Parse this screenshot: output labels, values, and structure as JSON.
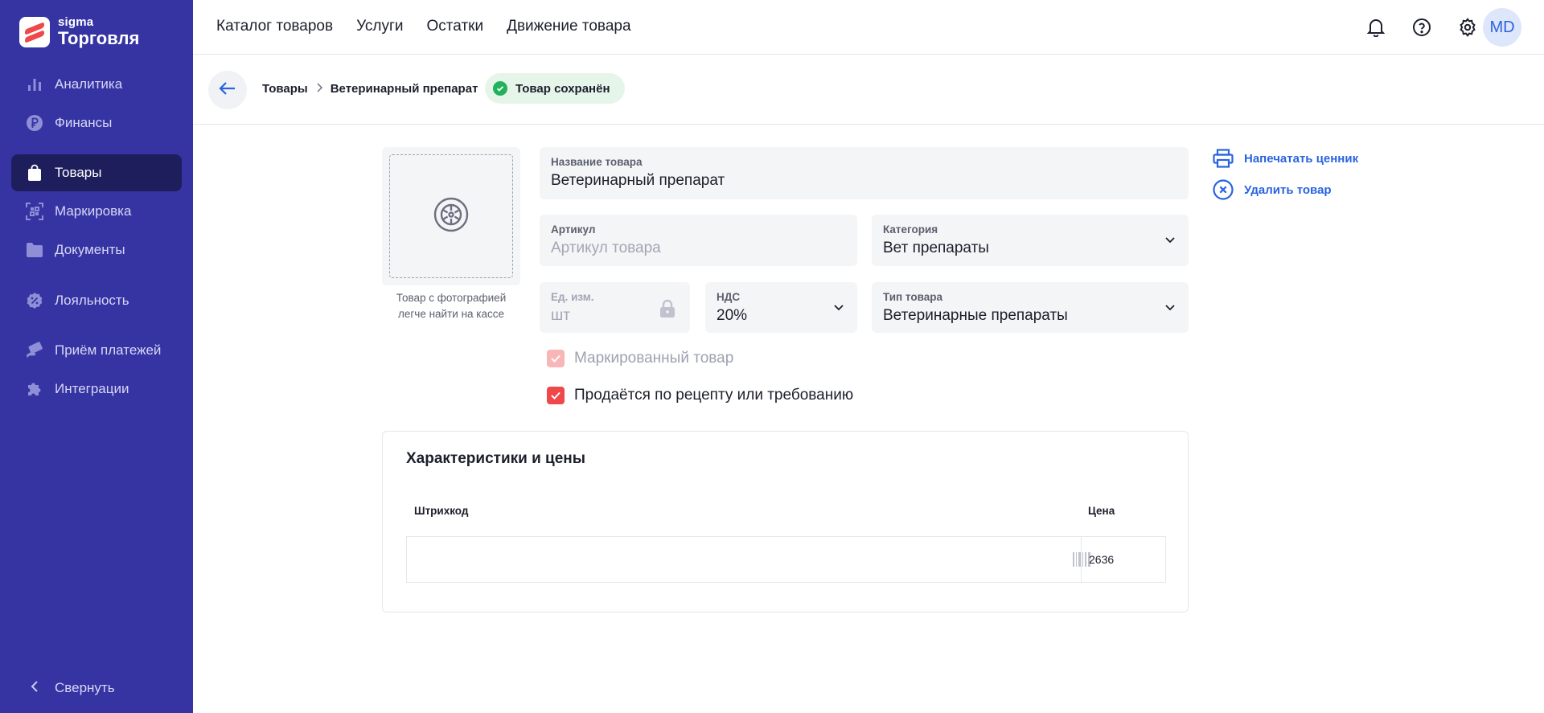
{
  "app": {
    "logo_small": "sigma",
    "logo_big": "Торговля"
  },
  "sidebar": {
    "items": [
      {
        "label": "Аналитика",
        "icon": "bar-chart-icon",
        "active": false
      },
      {
        "label": "Финансы",
        "icon": "ruble-icon",
        "active": false
      },
      {
        "label": "Товары",
        "icon": "shopping-bag-icon",
        "active": true
      },
      {
        "label": "Маркировка",
        "icon": "scan-code-icon",
        "active": false
      },
      {
        "label": "Документы",
        "icon": "folder-icon",
        "active": false
      },
      {
        "label": "Лояльность",
        "icon": "discount-badge-icon",
        "active": false
      },
      {
        "label": "Приём платежей",
        "icon": "payment-card-icon",
        "active": false
      },
      {
        "label": "Интеграции",
        "icon": "puzzle-icon",
        "active": false
      }
    ],
    "collapse_label": "Свернуть"
  },
  "topnav": {
    "links": [
      "Каталог товаров",
      "Услуги",
      "Остатки",
      "Движение товара"
    ],
    "avatar_initials": "MD"
  },
  "breadcrumb": {
    "items": [
      "Товары",
      "Ветеринарный препарат"
    ],
    "status": "Товар сохранён"
  },
  "product": {
    "photo_hint_line1": "Товар с фотографией",
    "photo_hint_line2": "легче найти на кассе",
    "name": {
      "label": "Название товара",
      "value": "Ветеринарный препарат"
    },
    "article": {
      "label": "Артикул",
      "placeholder": "Артикул товара"
    },
    "category": {
      "label": "Категория",
      "value": "Вет препараты"
    },
    "unit": {
      "label": "Ед. изм.",
      "value": "шт"
    },
    "vat": {
      "label": "НДС",
      "value": "20%"
    },
    "type": {
      "label": "Тип товара",
      "value": "Ветеринарные препараты"
    },
    "marked": {
      "label": "Маркированный товар",
      "checked": true,
      "disabled": true
    },
    "prescription": {
      "label": "Продаётся по рецепту или требованию",
      "checked": true
    }
  },
  "actions": {
    "print_label": "Напечатать ценник",
    "delete_label": "Удалить товар"
  },
  "characteristics": {
    "title": "Характеристики и цены",
    "columns": [
      "Штрихкод",
      "Цена"
    ],
    "rows": [
      {
        "barcode": "",
        "price": "2636"
      }
    ]
  },
  "colors": {
    "sidebar_bg": "#3634a3",
    "sidebar_active": "#1e1e5c",
    "accent_blue": "#2a63e0",
    "accent_red": "#f0474a",
    "success_green": "#22b25b"
  }
}
